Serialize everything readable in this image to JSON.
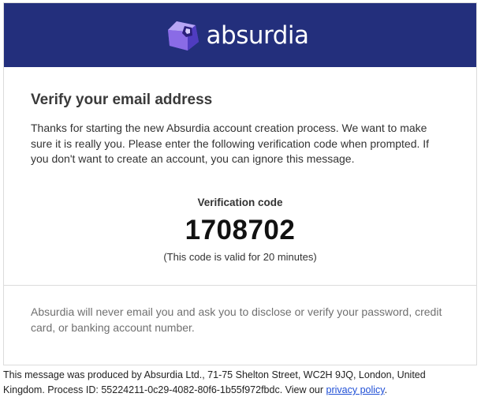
{
  "header": {
    "brand_name": "absurdia",
    "brand_color": "#232f7c",
    "logo_icon": "absurdia-cube-logo"
  },
  "main": {
    "title": "Verify your email address",
    "intro": "Thanks for starting the new Absurdia account creation process. We want to make sure it is really you. Please enter the following verification code when prompted. If you don't want to create an account, you can ignore this message.",
    "code_label": "Verification code",
    "code_value": "1708702",
    "code_note": "(This code is valid for 20 minutes)",
    "security_notice": "Absurdia will never email you and ask you to disclose or verify your password, credit card, or banking account number."
  },
  "footer": {
    "text": "This message was produced by Absurdia Ltd., 71-75 Shelton Street, WC2H 9JQ, London, United Kingdom. Process ID: 55224211-0c29-4082-80f6-1b55f972fbdc. View our ",
    "link_label": "privacy policy",
    "end": ".",
    "link_color": "#1f4fd6"
  }
}
